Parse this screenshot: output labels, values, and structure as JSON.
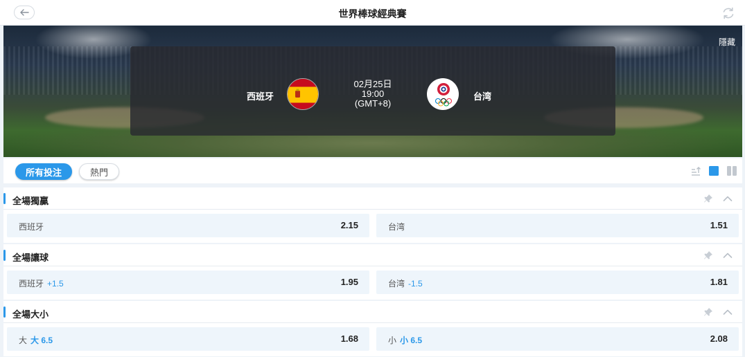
{
  "header": {
    "title": "世界棒球經典賽",
    "back_icon": "arrow-left-icon",
    "refresh_icon": "refresh-icon"
  },
  "banner": {
    "hide_label": "隱藏",
    "home_team": "西班牙",
    "away_team": "台湾",
    "date": "02月25日",
    "time": "19:00",
    "timezone": "(GMT+8)",
    "home_flag_icon": "spain-flag-icon",
    "away_flag_icon": "chinese-taipei-flag-icon"
  },
  "filters": {
    "tabs": [
      {
        "label": "所有投注",
        "active": true
      },
      {
        "label": "熱門",
        "active": false
      }
    ],
    "view_icons": [
      "sort-icon",
      "single-column-icon",
      "two-column-icon"
    ]
  },
  "markets": [
    {
      "title": "全場獨贏",
      "left": {
        "label": "西班牙",
        "handicap": "",
        "odds": "2.15"
      },
      "right": {
        "label": "台湾",
        "handicap": "",
        "odds": "1.51"
      }
    },
    {
      "title": "全場讓球",
      "left": {
        "label": "西班牙",
        "handicap": "+1.5",
        "odds": "1.95"
      },
      "right": {
        "label": "台湾",
        "handicap": "-1.5",
        "odds": "1.81"
      }
    },
    {
      "title": "全場大小",
      "left": {
        "label": "大",
        "handicap": "大 6.5",
        "odds": "1.68"
      },
      "right": {
        "label": "小",
        "handicap": "小 6.5",
        "odds": "2.08"
      }
    }
  ],
  "colors": {
    "accent": "#2b98e9",
    "cell_bg": "#eef5fb",
    "page_bg": "#eef3f8"
  }
}
